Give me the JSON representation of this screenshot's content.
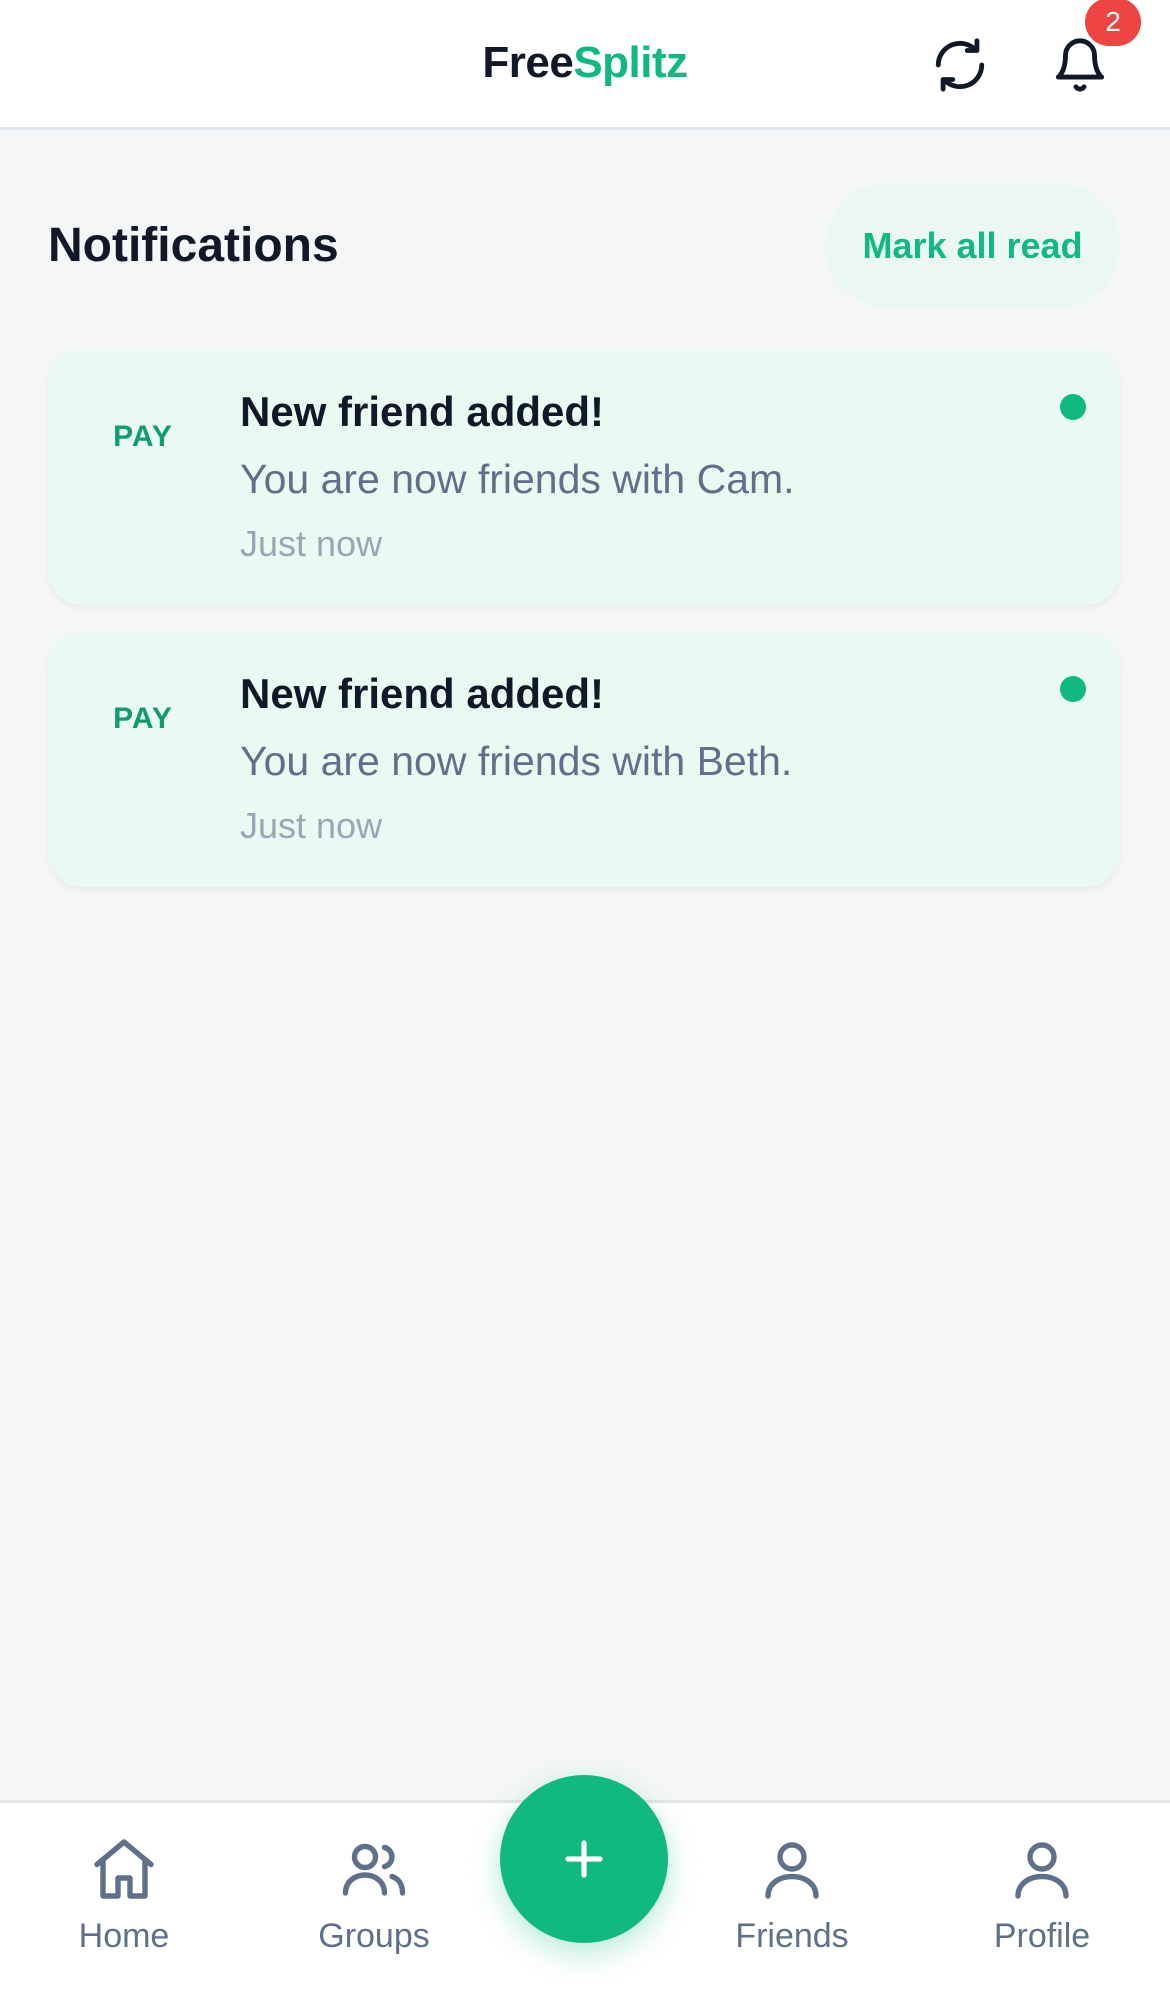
{
  "header": {
    "brand_part1": "Free",
    "brand_part2": "Splitz",
    "notification_count": "2",
    "refresh_icon": "refresh-icon",
    "bell_icon": "bell-icon"
  },
  "page": {
    "title": "Notifications",
    "mark_all_read_label": "Mark all read"
  },
  "notifications": [
    {
      "icon_label": "PAY",
      "title": "New friend added!",
      "message": "You are now friends with Cam.",
      "time": "Just now",
      "unread": true
    },
    {
      "icon_label": "PAY",
      "title": "New friend added!",
      "message": "You are now friends with Beth.",
      "time": "Just now",
      "unread": true
    }
  ],
  "bottom_nav": {
    "items": [
      {
        "label": "Home",
        "icon": "home-icon"
      },
      {
        "label": "Groups",
        "icon": "groups-icon"
      },
      {
        "label": "Friends",
        "icon": "friends-icon"
      },
      {
        "label": "Profile",
        "icon": "profile-icon"
      }
    ],
    "fab_icon": "plus-icon"
  },
  "colors": {
    "accent": "#10b981",
    "badge": "#ef4444",
    "card_bg": "#eafaf2",
    "text_dark": "#111827",
    "text_muted": "#617089"
  }
}
